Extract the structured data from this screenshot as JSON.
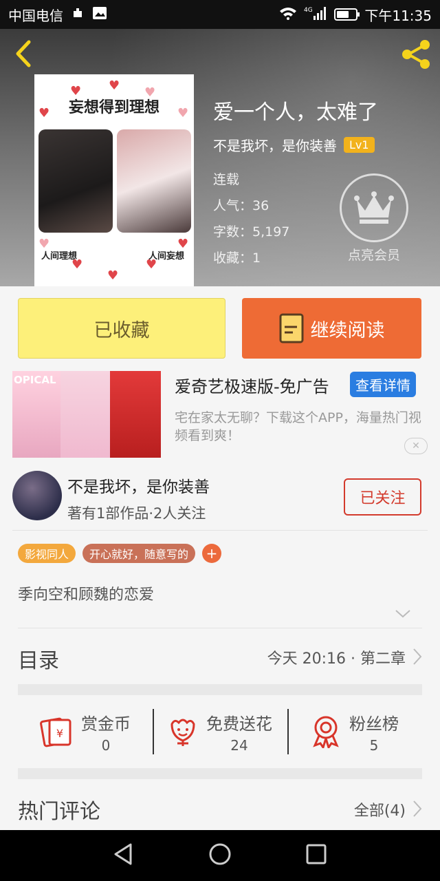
{
  "status_bar": {
    "carrier": "中国电信",
    "time": "下午11:35",
    "network": "4G",
    "battery_percent": 70
  },
  "book": {
    "title": "爱一个人，太难了",
    "author": "不是我坏，是你装善",
    "level": "Lv1",
    "status": "连载",
    "popularity": "人气：36",
    "word_count": "字数：5,197",
    "favorites": "收藏：1",
    "vip_label": "点亮会员",
    "cover": {
      "title": "妄想得到理想",
      "caption_left": "人间理想",
      "caption_right": "人间妄想"
    }
  },
  "actions": {
    "collected_label": "已收藏",
    "read_label": "继续阅读"
  },
  "ad": {
    "title": "爱奇艺极速版-免广告",
    "detail_label": "查看详情",
    "description": "宅在家太无聊？下载这个APP，海量热门视频看到爽！",
    "image_tag": "OPICAL"
  },
  "author_card": {
    "name": "不是我坏，是你装善",
    "stats": "著有1部作品·2人关注",
    "follow_label": "已关注"
  },
  "tags": [
    "影视同人",
    "开心就好，随意写的"
  ],
  "synopsis": "季向空和顾魏的恋爱",
  "catalog": {
    "label": "目录",
    "latest": "今天 20:16 · 第二章"
  },
  "stats": [
    {
      "label": "赏金币",
      "value": "0",
      "icon": "red-envelope-icon"
    },
    {
      "label": "免费送花",
      "value": "24",
      "icon": "flower-icon"
    },
    {
      "label": "粉丝榜",
      "value": "5",
      "icon": "medal-icon"
    }
  ],
  "comments": {
    "label": "热门评论",
    "all_label": "全部(4)"
  },
  "colors": {
    "accent_orange": "#ee6b35",
    "collected_yellow": "#fdf07a",
    "follow_red": "#d33a2c",
    "level_badge": "#f2b21c",
    "ad_button_blue": "#2a7de1"
  }
}
